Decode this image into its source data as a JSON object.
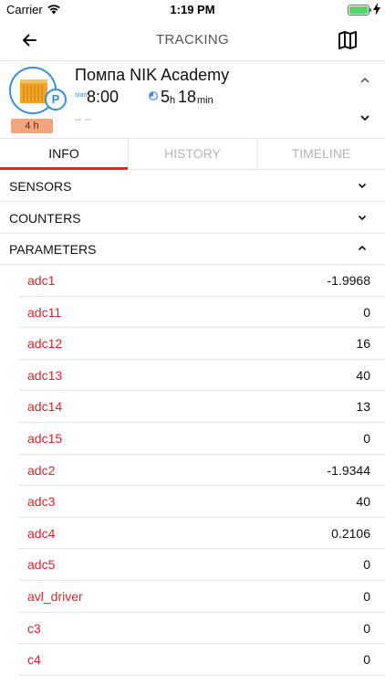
{
  "status_bar": {
    "carrier": "Carrier",
    "time": "1:19 PM",
    "battery_level": 1.0
  },
  "nav": {
    "title": "TRACKING",
    "back_icon": "arrow-left-icon",
    "map_icon": "folded-map-icon"
  },
  "object": {
    "name": "Помпа NIK Academy",
    "start_label": "start",
    "start_time": "8:00",
    "duration_hours": "5",
    "hours_unit": "h",
    "duration_minutes": "18",
    "minutes_unit": "min",
    "address": "-- --",
    "status_badge": "P",
    "parking_duration": "4 h",
    "colors": {
      "accent": "#3a8ed8",
      "badge": "#f4a47c"
    }
  },
  "tabs": [
    {
      "label": "INFO",
      "active": true
    },
    {
      "label": "HISTORY",
      "active": false
    },
    {
      "label": "TIMELINE",
      "active": false
    }
  ],
  "sections": {
    "sensors": {
      "label": "SENSORS",
      "expanded": false
    },
    "counters": {
      "label": "COUNTERS",
      "expanded": false
    },
    "parameters": {
      "label": "PARAMETERS",
      "expanded": true
    }
  },
  "parameters": [
    {
      "name": "adc1",
      "value": "-1.9968"
    },
    {
      "name": "adc11",
      "value": "0"
    },
    {
      "name": "adc12",
      "value": "16"
    },
    {
      "name": "adc13",
      "value": "40"
    },
    {
      "name": "adc14",
      "value": "13"
    },
    {
      "name": "adc15",
      "value": "0"
    },
    {
      "name": "adc2",
      "value": "-1.9344"
    },
    {
      "name": "adc3",
      "value": "40"
    },
    {
      "name": "adc4",
      "value": "0.2106"
    },
    {
      "name": "adc5",
      "value": "0"
    },
    {
      "name": "avl_driver",
      "value": "0"
    },
    {
      "name": "c3",
      "value": "0"
    },
    {
      "name": "c4",
      "value": "0"
    }
  ],
  "colors": {
    "brand_red": "#e0252b",
    "divider": "#e6e6e6"
  }
}
